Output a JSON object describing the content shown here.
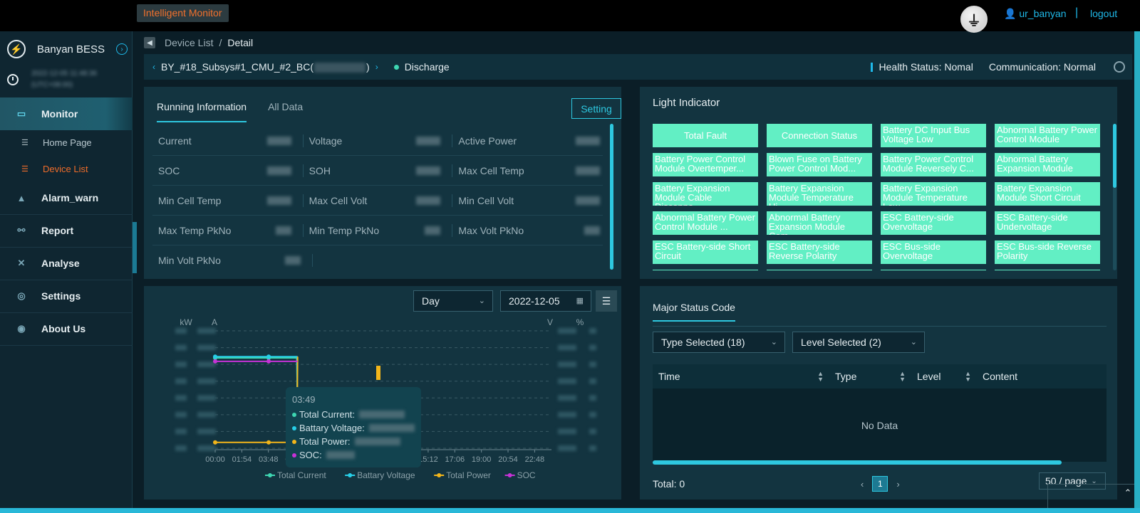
{
  "topbar": {
    "app_title": "Intelligent Monitor",
    "user": "ur_banyan",
    "separator": "|",
    "logout": "logout"
  },
  "sidebar": {
    "brand": "Banyan BESS",
    "clock_line1": "2022-12-05 11:48:36",
    "clock_line2": "(UTC+08:00)",
    "monitor": "Monitor",
    "home_page": "Home Page",
    "device_list": "Device List",
    "alarm": "Alarm_warn",
    "report": "Report",
    "analyse": "Analyse",
    "settings": "Settings",
    "about": "About Us"
  },
  "breadcrumb": {
    "parent": "Device List",
    "sep": "/",
    "current": "Detail"
  },
  "device": {
    "name_prefix": "BY_#18_Subsys#1_CMU_#2_BC(",
    "name_suffix": ")",
    "mode": "Discharge",
    "health": "Health Status:  Nomal",
    "communication": "Communication:  Normal"
  },
  "running": {
    "tab_running": "Running Information",
    "tab_all": "All Data",
    "setting_btn": "Setting",
    "labels": {
      "current": "Current",
      "voltage": "Voltage",
      "active_power": "Active Power",
      "soc": "SOC",
      "soh": "SOH",
      "max_cell_temp": "Max Cell Temp",
      "min_cell_temp": "Min Cell Temp",
      "max_cell_volt": "Max Cell Volt",
      "min_cell_volt": "Min Cell Volt",
      "max_temp_pkno": "Max Temp PkNo",
      "min_temp_pkno": "Min Temp PkNo",
      "max_volt_pkno": "Max Volt PkNo",
      "min_volt_pkno": "Min Volt PkNo"
    }
  },
  "light": {
    "title": "Light Indicator",
    "items": [
      "Total Fault",
      "Connection Status",
      "Battery DC Input Bus Voltage Low",
      "Abnormal Battery Power Control Module",
      "Battery Power Control Module Overtemper...",
      "Blown Fuse on Battery Power Control Mod...",
      "Battery Power Control Module Reversely C...",
      "Abnormal Battery Expansion Module",
      "Battery Expansion Module Cable Disconne...",
      "Battery Expansion Module Temperature Hi...",
      "Battery Expansion Module Temperature Low",
      "Battery Expansion Module Short Circuit",
      "Abnormal Battery Power Control Module ...",
      "Abnormal Battery Expansion Module Com...",
      "ESC Battery-side Overvoltage",
      "ESC Battery-side Undervoltage",
      "ESC Battery-side Short Circuit",
      "ESC Battery-side Reverse Polarity",
      "ESC Bus-side Overvoltage",
      "ESC Bus-side Reverse Polarity",
      "",
      "",
      "",
      ""
    ],
    "color": "#62efc4"
  },
  "chart_controls": {
    "period": "Day",
    "date": "2022-12-05"
  },
  "tooltip": {
    "time": "03:49",
    "total_current": "Total Current:",
    "battery_voltage": "Battary Voltage:",
    "total_power": "Total Power:",
    "soc": "SOC:"
  },
  "chart_data": {
    "type": "line",
    "x_ticks": [
      "00:00",
      "01:54",
      "03:48",
      "05:42",
      "07:36",
      "09:30",
      "11:24",
      "13:18",
      "15:12",
      "17:06",
      "19:00",
      "20:54",
      "22:48"
    ],
    "axis_units": {
      "power": "kW",
      "current": "A",
      "voltage": "V",
      "soc": "%"
    },
    "series": [
      {
        "name": "Total Current",
        "color": "#3ed6b2",
        "x": [
          "00:00",
          "03:49",
          "05:50",
          "05:52"
        ],
        "y_norm": [
          0.77,
          0.77,
          0.77,
          0.35
        ]
      },
      {
        "name": "Battary Voltage",
        "color": "#27cfe8",
        "x": [
          "00:00",
          "03:49",
          "05:50",
          "05:52"
        ],
        "y_norm": [
          0.78,
          0.78,
          0.78,
          0.36
        ]
      },
      {
        "name": "Total Power",
        "color": "#f2b51a",
        "x": [
          "00:00",
          "03:49",
          "05:50",
          "05:53"
        ],
        "y_norm": [
          0.05,
          0.05,
          0.05,
          0.78
        ]
      },
      {
        "name": "SOC",
        "color": "#c632d6",
        "x": [
          "00:00",
          "03:49",
          "05:50",
          "05:53"
        ],
        "y_norm": [
          0.74,
          0.74,
          0.74,
          0.74
        ]
      }
    ],
    "grid": true,
    "legend": "bottom"
  },
  "status_code": {
    "title": "Major Status Code",
    "type_select": "Type Selected (18)",
    "level_select": "Level Selected (2)",
    "columns": [
      "Time",
      "Type",
      "Level",
      "Content"
    ],
    "empty": "No Data",
    "total": "Total: 0",
    "page": "1",
    "page_size": "50 / page"
  }
}
